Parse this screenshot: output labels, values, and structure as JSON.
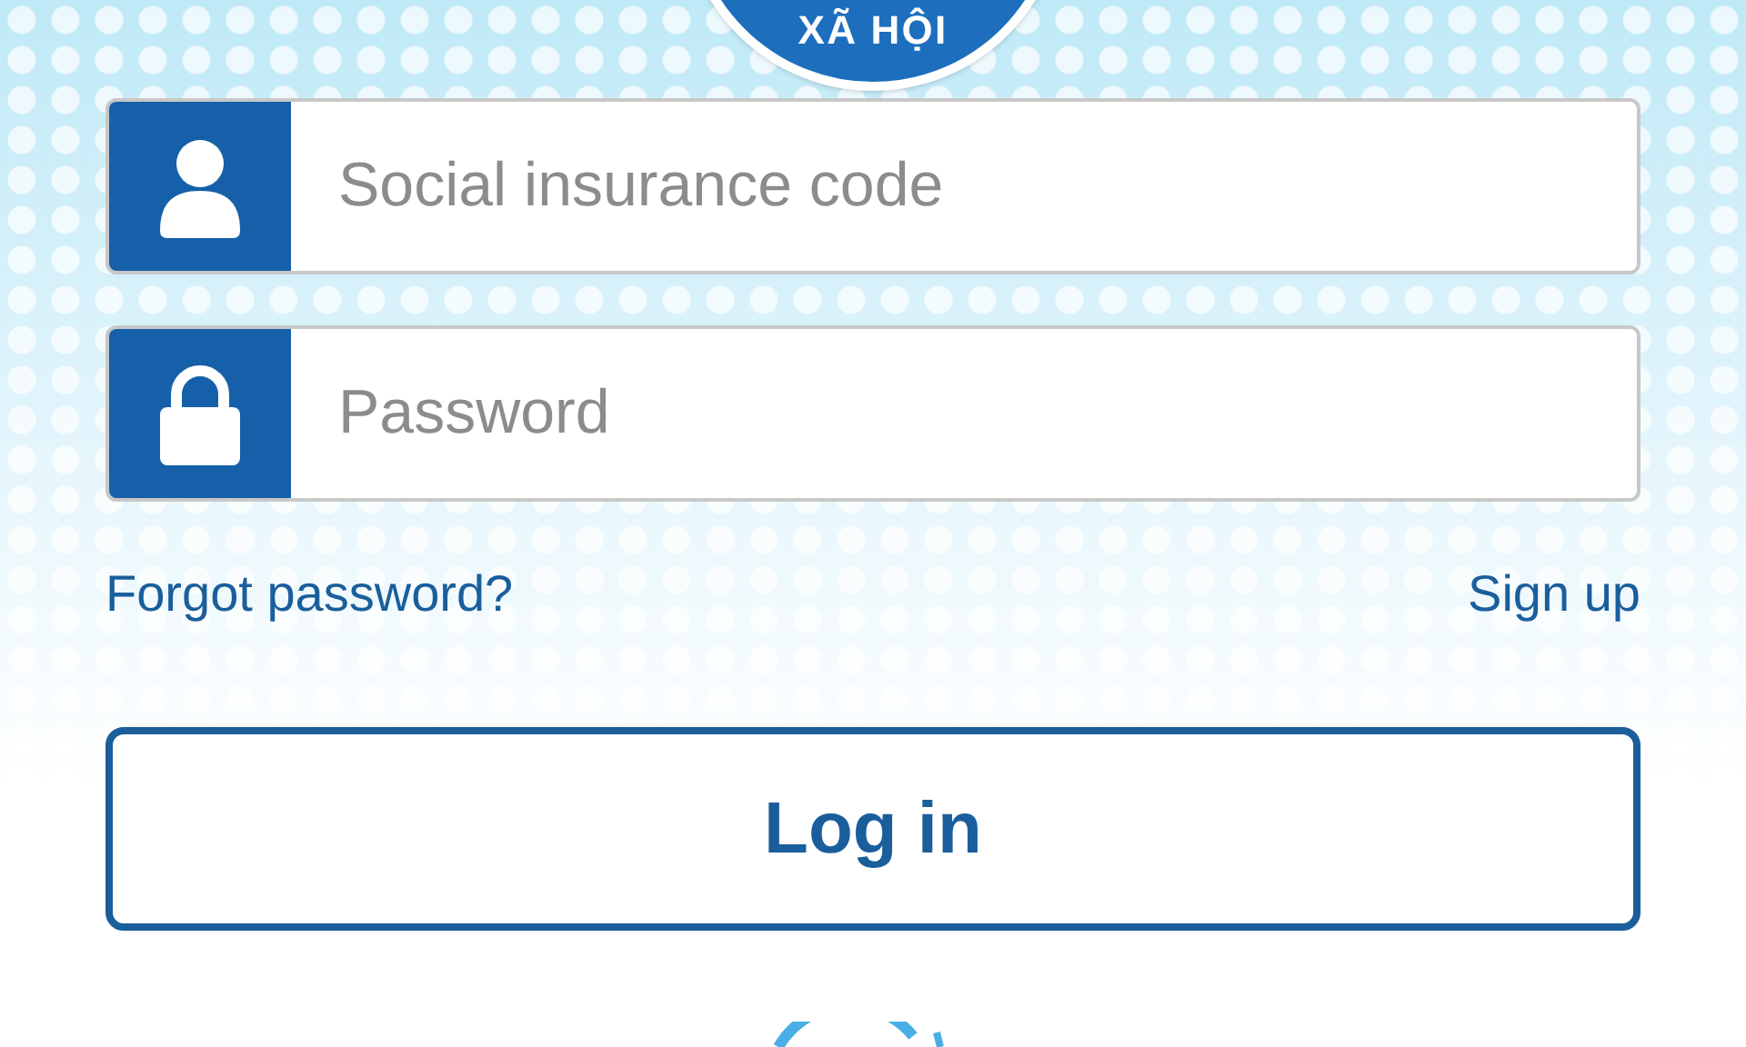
{
  "logo": {
    "text": "XÃ HỘI"
  },
  "fields": [
    {
      "kind": "user",
      "placeholder": "Social insurance code"
    },
    {
      "kind": "password",
      "placeholder": "Password"
    }
  ],
  "links": [
    {
      "label": "Forgot password?"
    },
    {
      "label": "Sign up"
    }
  ],
  "login_button": {
    "label": "Log in"
  }
}
